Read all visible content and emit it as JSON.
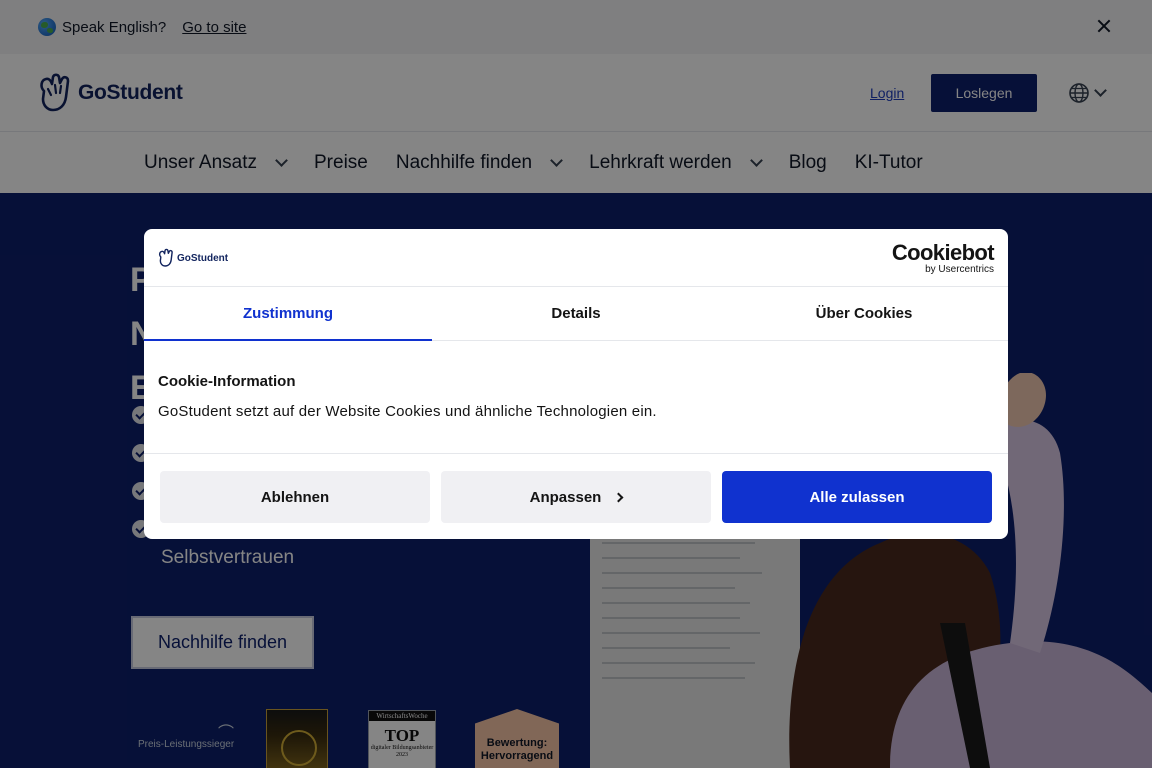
{
  "banner": {
    "text": "Speak English?",
    "link": "Go to site",
    "icon": "globe-emoji-icon"
  },
  "header": {
    "logo_text": "GoStudent",
    "login": "Login",
    "cta": "Loslegen",
    "language_icon": "globe-icon"
  },
  "nav": {
    "items": [
      {
        "label": "Unser Ansatz",
        "dropdown": true
      },
      {
        "label": "Preise",
        "dropdown": false
      },
      {
        "label": "Nachhilfe finden",
        "dropdown": true
      },
      {
        "label": "Lehrkraft werden",
        "dropdown": true
      },
      {
        "label": "Blog",
        "dropdown": false
      },
      {
        "label": "KI-Tutor",
        "dropdown": false
      }
    ]
  },
  "hero": {
    "headline_lines": [
      "P",
      "N",
      "E"
    ],
    "bullets": [
      {
        "text": ""
      },
      {
        "text": ""
      },
      {
        "text": ""
      },
      {
        "text": "Für bessere Noten und mehr Selbstvertrauen"
      }
    ],
    "cta": "Nachhilfe finden",
    "awards": {
      "award1": "Preis-Leistungssieger",
      "award3_top": "WirtschaftsWoche",
      "award3_main": "TOP",
      "award3_sub": "digitaler Bildungsanbieter",
      "award3_year": "2023",
      "award4_line1": "Bewertung:",
      "award4_line2": "Hervorragend"
    }
  },
  "cookie_dialog": {
    "logo_text": "GoStudent",
    "brand": "Cookiebot",
    "brand_sub": "by Usercentrics",
    "tabs": [
      {
        "label": "Zustimmung",
        "active": true
      },
      {
        "label": "Details",
        "active": false
      },
      {
        "label": "Über Cookies",
        "active": false
      }
    ],
    "title": "Cookie-Information",
    "text": "GoStudent setzt auf der Website Cookies und ähnliche Technologien ein.",
    "buttons": {
      "reject": "Ablehnen",
      "customize": "Anpassen",
      "accept": "Alle zulassen"
    }
  },
  "colors": {
    "brand_navy": "#0d1f6b",
    "cookiebot_blue": "#1032cf",
    "link_blue": "#1f3fbf"
  }
}
